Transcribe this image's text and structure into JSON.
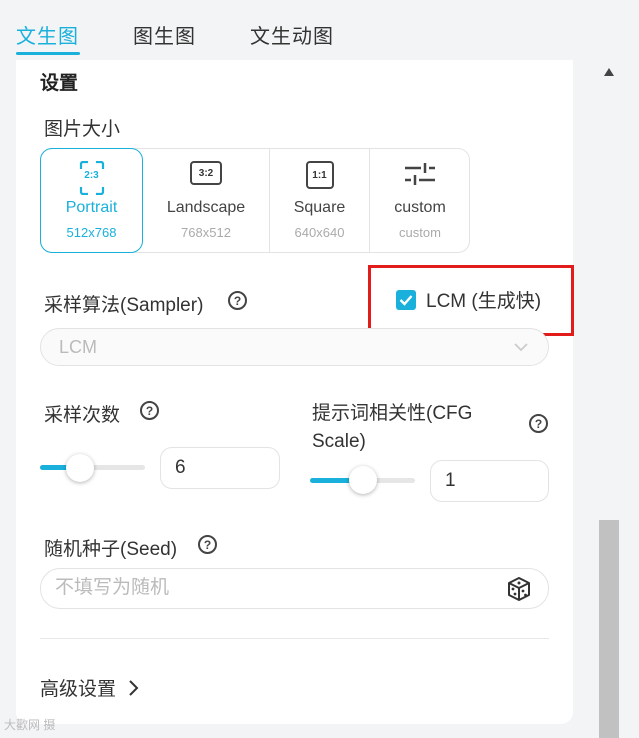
{
  "tabs": [
    {
      "label": "文生图",
      "active": true
    },
    {
      "label": "图生图",
      "active": false
    },
    {
      "label": "文生动图",
      "active": false
    }
  ],
  "settings": {
    "title": "设置",
    "image_size": {
      "label": "图片大小",
      "options": [
        {
          "ratio": "2:3",
          "name": "Portrait",
          "dims": "512x768",
          "selected": true
        },
        {
          "ratio": "3:2",
          "name": "Landscape",
          "dims": "768x512",
          "selected": false
        },
        {
          "ratio": "1:1",
          "name": "Square",
          "dims": "640x640",
          "selected": false
        },
        {
          "ratio": "",
          "name": "custom",
          "dims": "custom",
          "selected": false,
          "icon": "sliders-icon"
        }
      ]
    },
    "sampler": {
      "label": "采样算法(Sampler)",
      "help": "?",
      "lcm_checkbox_label": "LCM (生成快)",
      "lcm_checked": true,
      "select_value": "LCM"
    },
    "steps": {
      "label": "采样次数",
      "help": "?",
      "value": "6",
      "slider_fraction": 0.38
    },
    "cfg": {
      "label_line1": "提示词相关性(CFG",
      "label_line2": "Scale)",
      "help": "?",
      "value": "1",
      "slider_fraction": 0.5
    },
    "seed": {
      "label": "随机种子(Seed)",
      "help": "?",
      "placeholder": "不填写为随机"
    },
    "advanced_label": "高级设置"
  },
  "watermark": "大歡网 摄",
  "colors": {
    "accent": "#1ab0dc",
    "highlight_box": "#e21b1b"
  }
}
